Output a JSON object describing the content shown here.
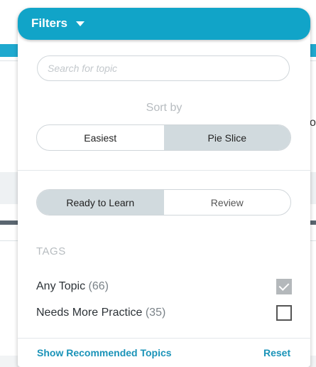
{
  "header": {
    "title": "Filters"
  },
  "search": {
    "placeholder": "Search for topic"
  },
  "sort": {
    "label": "Sort by",
    "options": [
      {
        "label": "Easiest",
        "active": false
      },
      {
        "label": "Pie Slice",
        "active": true
      }
    ]
  },
  "mode": {
    "options": [
      {
        "label": "Ready to Learn",
        "active": true
      },
      {
        "label": "Review",
        "active": false
      }
    ]
  },
  "tags": {
    "title": "TAGS",
    "items": [
      {
        "name": "Any Topic",
        "count": "(66)",
        "checked": true
      },
      {
        "name": "Needs More Practice",
        "count": "(35)",
        "checked": false
      }
    ]
  },
  "footer": {
    "recommended": "Show Recommended Topics",
    "reset": "Reset"
  },
  "background": {
    "fragment": "o"
  },
  "colors": {
    "header": "#11a4c8",
    "link": "#1a93b8",
    "segment_active": "#d1dade"
  }
}
